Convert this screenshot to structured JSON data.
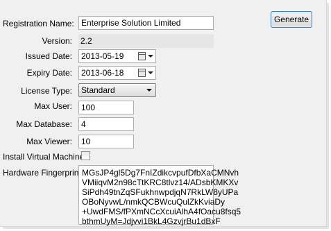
{
  "form": {
    "registration_name": {
      "label": "Registration Name:",
      "value": "Enterprise Solution Limited"
    },
    "version": {
      "label": "Version:",
      "value": "2.2"
    },
    "issued_date": {
      "label": "Issued Date:",
      "value": "2013-05-19"
    },
    "expiry_date": {
      "label": "Expiry Date:",
      "value": "2013-06-18"
    },
    "license_type": {
      "label": "License Type:",
      "value": "Standard"
    },
    "max_user": {
      "label": "Max User:",
      "value": "100"
    },
    "max_database": {
      "label": "Max Database:",
      "value": "4"
    },
    "max_viewer": {
      "label": "Max Viewer:",
      "value": "10"
    },
    "install_vm": {
      "label": "Install Virtual Machine",
      "checked": false
    },
    "hardware_fingerprint": {
      "label": "Hardware Fingerprint:",
      "lines": [
        "MGsJP4gl5Dg7FnIZdikcvpufDfbXaCMNvh",
        "VMiiqvM2n98cTtKRC8tlvz14/ADsbKMKXv",
        "SiPdh49tnZqSFukhnwpdjqN7RkLW8yUPa",
        "OBoNyvwL/nmkQCBWcuQulZkKviaDy",
        "+UwdFMS/fPXmNCcXcuiAlhA4fOacu8fsq5",
        "bthmUyM=Jdjvvi1BkL4GzvjrBu1dBxF"
      ]
    }
  },
  "buttons": {
    "generate": "Generate"
  },
  "icons": {
    "date_picker": "calendar-icon",
    "dropdown": "chevron-down-icon"
  },
  "colors": {
    "window_bg": "#f0f0f0",
    "readonly_bg": "#e6e6e6",
    "button_border": "#3c7fb1"
  }
}
